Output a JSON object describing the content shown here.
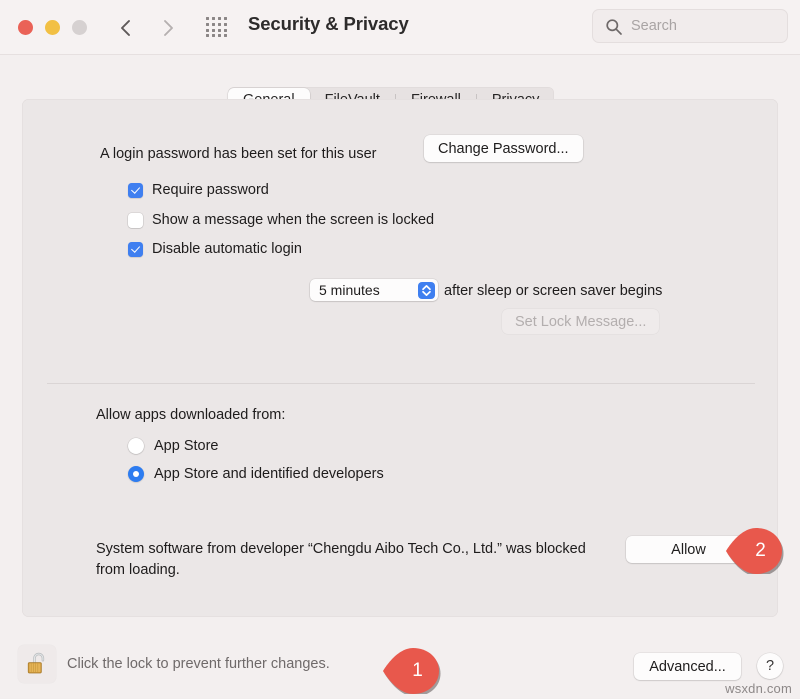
{
  "titlebar": {
    "title": "Security & Privacy",
    "traffic_lights": [
      {
        "name": "close",
        "color": "#ea6257"
      },
      {
        "name": "minimize",
        "color": "#f2c044"
      },
      {
        "name": "maximize",
        "color": "#d6d1d1"
      }
    ],
    "back_label": "Back",
    "forward_label": "Forward",
    "grid_label": "Show All",
    "search": {
      "placeholder": "Search",
      "value": ""
    }
  },
  "tabs": [
    {
      "label": "General",
      "active": true
    },
    {
      "label": "FileVault",
      "active": false
    },
    {
      "label": "Firewall",
      "active": false
    },
    {
      "label": "Privacy",
      "active": false
    }
  ],
  "general": {
    "login_password_text": "A login password has been set for this user",
    "change_password_label": "Change Password...",
    "require_password": {
      "label": "Require password",
      "checked": true,
      "interval_value": "5 minutes",
      "suffix": "after sleep or screen saver begins"
    },
    "show_message": {
      "label": "Show a message when the screen is locked",
      "checked": false,
      "button_label": "Set Lock Message...",
      "button_disabled": true
    },
    "disable_auto_login": {
      "label": "Disable automatic login",
      "checked": true
    },
    "allow_apps_label": "Allow apps downloaded from:",
    "allow_apps_options": [
      {
        "label": "App Store",
        "selected": false
      },
      {
        "label": "App Store and identified developers",
        "selected": true
      }
    ],
    "blocked_message": "System software from developer “Chengdu Aibo Tech Co., Ltd.” was blocked from loading.",
    "allow_button_label": "Allow"
  },
  "footer": {
    "lock_text": "Click the lock to prevent further changes.",
    "lock_state": "unlocked",
    "advanced_label": "Advanced...",
    "help_label": "?"
  },
  "annotations": [
    {
      "number": "1",
      "color": "#e8584c"
    },
    {
      "number": "2",
      "color": "#e8584c"
    }
  ],
  "watermark": "wsxdn.com"
}
